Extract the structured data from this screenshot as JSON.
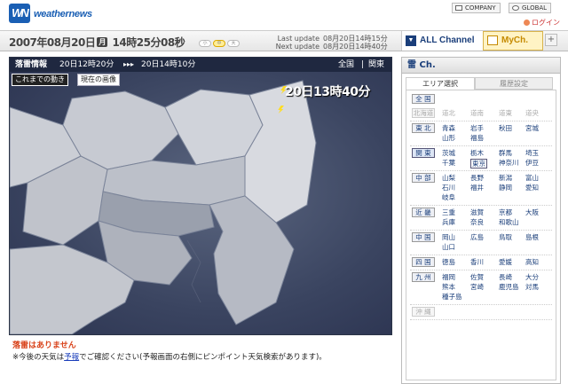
{
  "header": {
    "logo_mark": "WN",
    "logo_text": "weathernews",
    "company_label": "COMPANY",
    "global_label": "GLOBAL",
    "login_label": "ログイン"
  },
  "datebar": {
    "year": "2007",
    "month": "08",
    "day": "20",
    "dow": "月",
    "hour": "14",
    "minute": "25",
    "second": "08",
    "sep_year": "年",
    "sep_month": "月",
    "sep_day": "日",
    "sep_hour": "時",
    "sep_min": "分",
    "sep_sec": "秒",
    "pills": [
      "小",
      "中",
      "大"
    ],
    "last_update_label": "Last update",
    "last_update_value": "08月20日14時15分",
    "next_update_label": "Next update",
    "next_update_value": "08月20日14時40分"
  },
  "channels": {
    "all_label": "ALL Channel",
    "my_label": "MyCh.",
    "plus_label": "+"
  },
  "map": {
    "title": "落雷情報",
    "from_time": "20日12時20分",
    "arrow": "▸▸▸",
    "to_time": "20日14時10分",
    "region_nation": "全国",
    "region_sep": "|",
    "region_local": "関東",
    "btn_history": "これまでの動き",
    "btn_current": "現在の画像",
    "overlay_time": "20日13時40分"
  },
  "below": {
    "no_lightning": "落雷はありません",
    "note_prefix": "※今後の天気は",
    "note_link": "予報",
    "note_suffix": "でご確認ください(予報画面の右側にピンポイント天気検索があります)。"
  },
  "sidebar": {
    "title": "雷 Ch.",
    "tab_area": "エリア選択",
    "tab_history": "履歴設定",
    "nation": "全 国",
    "regions": [
      {
        "name": "北海道",
        "disabled": true,
        "prefs": [
          "道北",
          "道南",
          "道東",
          "道央"
        ]
      },
      {
        "name": "東 北",
        "prefs": [
          "青森",
          "岩手",
          "秋田",
          "宮城",
          "山形",
          "福島"
        ]
      },
      {
        "name": "関 東",
        "current": true,
        "prefs": [
          "茨城",
          "栃木",
          "群馬",
          "埼玉",
          "千葉",
          "東京",
          "神奈川",
          "伊豆"
        ]
      },
      {
        "name": "中 部",
        "prefs": [
          "山梨",
          "長野",
          "新潟",
          "富山",
          "石川",
          "福井",
          "静岡",
          "愛知",
          "岐阜"
        ]
      },
      {
        "name": "近 畿",
        "prefs": [
          "三重",
          "滋賀",
          "京都",
          "大阪",
          "兵庫",
          "奈良",
          "和歌山"
        ]
      },
      {
        "name": "中 国",
        "prefs": [
          "岡山",
          "広島",
          "鳥取",
          "島根",
          "山口"
        ]
      },
      {
        "name": "四 国",
        "prefs": [
          "徳島",
          "香川",
          "愛媛",
          "高知"
        ]
      },
      {
        "name": "九 州",
        "prefs": [
          "福岡",
          "佐賀",
          "長崎",
          "大分",
          "熊本",
          "宮崎",
          "鹿児島",
          "対馬",
          "種子島"
        ]
      },
      {
        "name": "沖 縄",
        "disabled": true,
        "prefs": []
      }
    ]
  },
  "colors": {
    "brand_blue": "#1a5fb4",
    "map_bg": "#3a4460",
    "alert_red": "#d9441c",
    "mych_gold": "#c58a00"
  }
}
